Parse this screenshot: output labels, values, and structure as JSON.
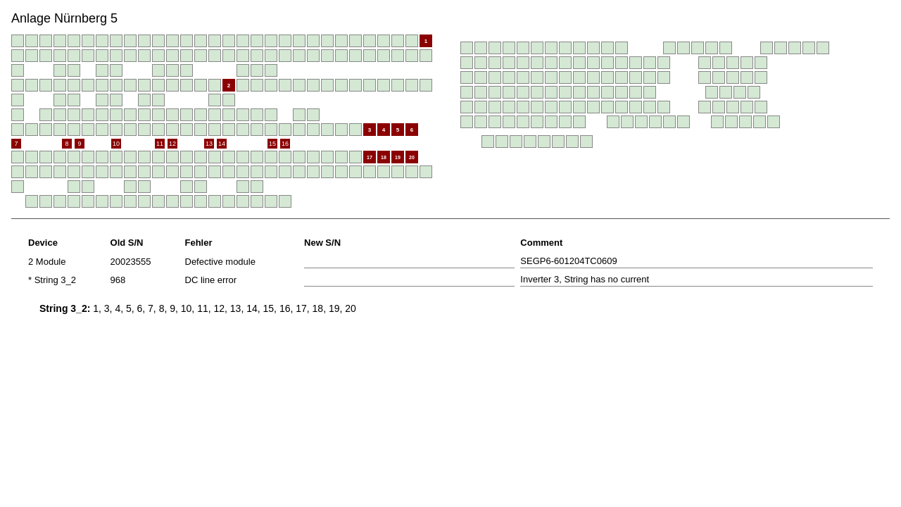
{
  "title": "Anlage Nürnberg 5",
  "leftPanel": {
    "rows": [
      {
        "type": "modules",
        "count": 30,
        "specials": [
          {
            "index": 29,
            "label": "1"
          }
        ]
      },
      {
        "type": "modules",
        "count": 30,
        "specials": []
      },
      {
        "type": "sparse",
        "cells": [
          {
            "pos": 0,
            "type": "single"
          },
          {
            "pos": 2,
            "type": "double"
          },
          {
            "pos": 4,
            "type": "double"
          },
          {
            "pos": 6,
            "type": "double"
          },
          {
            "pos": 10,
            "type": "triple"
          },
          {
            "pos": 14,
            "type": "triple"
          }
        ]
      },
      {
        "type": "modules",
        "count": 30,
        "specials": [
          {
            "index": 15,
            "label": "2"
          }
        ]
      },
      {
        "type": "sparse2"
      },
      {
        "type": "sparse3"
      },
      {
        "type": "modules",
        "count": 30,
        "specials": [
          {
            "index": 25,
            "label": "3"
          },
          {
            "index": 26,
            "label": "4"
          },
          {
            "index": 27,
            "label": "5"
          },
          {
            "index": 28,
            "label": "6"
          }
        ]
      },
      {
        "type": "numbers_row"
      },
      {
        "type": "modules",
        "count": 30,
        "specials": [
          {
            "index": 25,
            "label": "17"
          },
          {
            "index": 26,
            "label": "18"
          },
          {
            "index": 27,
            "label": "19"
          },
          {
            "index": 28,
            "label": "20"
          }
        ]
      },
      {
        "type": "modules",
        "count": 30,
        "specials": []
      },
      {
        "type": "sparse4"
      },
      {
        "type": "bottom_row"
      }
    ]
  },
  "table": {
    "headers": {
      "device": "Device",
      "old_sn": "Old S/N",
      "fehler": "Fehler",
      "new_sn": "New S/N",
      "comment": "Comment"
    },
    "rows": [
      {
        "prefix": "",
        "device": "2  Module",
        "old_sn": "20023555",
        "fehler": "Defective module",
        "new_sn": "",
        "new_sn_placeholder": "",
        "comment": "SEGP6-601204TC0609",
        "comment_placeholder": ""
      },
      {
        "prefix": "*",
        "device": "String 3_2",
        "old_sn": "968",
        "fehler": "DC line error",
        "new_sn": "",
        "new_sn_placeholder": "",
        "comment": "Inverter 3, String has no current",
        "comment_placeholder": ""
      }
    ]
  },
  "stringInfo": {
    "label": "String 3_2:",
    "values": "1, 3, 4, 5, 6, 7, 8, 9, 10, 11, 12, 13, 14, 15, 16, 17, 18, 19, 20"
  }
}
